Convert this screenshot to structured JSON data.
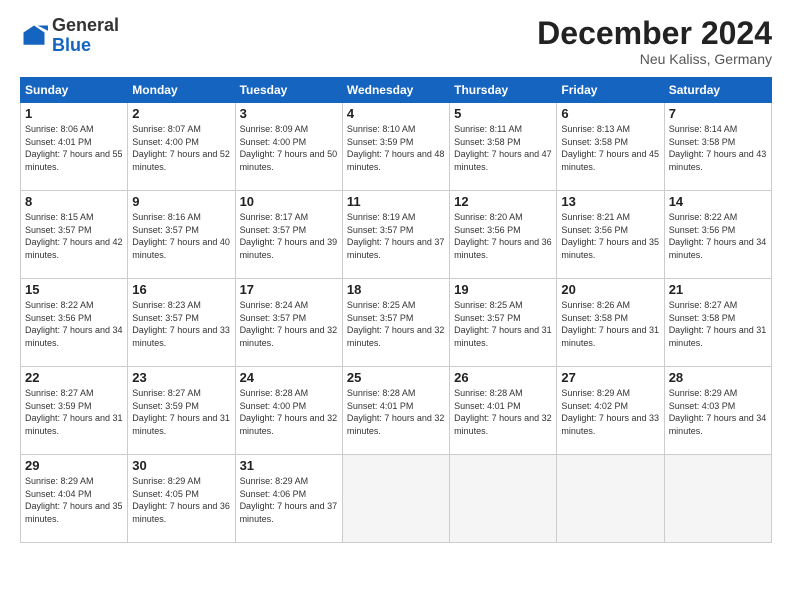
{
  "header": {
    "logo_general": "General",
    "logo_blue": "Blue",
    "month_title": "December 2024",
    "location": "Neu Kaliss, Germany"
  },
  "weekdays": [
    "Sunday",
    "Monday",
    "Tuesday",
    "Wednesday",
    "Thursday",
    "Friday",
    "Saturday"
  ],
  "weeks": [
    [
      {
        "day": "1",
        "sunrise": "Sunrise: 8:06 AM",
        "sunset": "Sunset: 4:01 PM",
        "daylight": "Daylight: 7 hours and 55 minutes."
      },
      {
        "day": "2",
        "sunrise": "Sunrise: 8:07 AM",
        "sunset": "Sunset: 4:00 PM",
        "daylight": "Daylight: 7 hours and 52 minutes."
      },
      {
        "day": "3",
        "sunrise": "Sunrise: 8:09 AM",
        "sunset": "Sunset: 4:00 PM",
        "daylight": "Daylight: 7 hours and 50 minutes."
      },
      {
        "day": "4",
        "sunrise": "Sunrise: 8:10 AM",
        "sunset": "Sunset: 3:59 PM",
        "daylight": "Daylight: 7 hours and 48 minutes."
      },
      {
        "day": "5",
        "sunrise": "Sunrise: 8:11 AM",
        "sunset": "Sunset: 3:58 PM",
        "daylight": "Daylight: 7 hours and 47 minutes."
      },
      {
        "day": "6",
        "sunrise": "Sunrise: 8:13 AM",
        "sunset": "Sunset: 3:58 PM",
        "daylight": "Daylight: 7 hours and 45 minutes."
      },
      {
        "day": "7",
        "sunrise": "Sunrise: 8:14 AM",
        "sunset": "Sunset: 3:58 PM",
        "daylight": "Daylight: 7 hours and 43 minutes."
      }
    ],
    [
      {
        "day": "8",
        "sunrise": "Sunrise: 8:15 AM",
        "sunset": "Sunset: 3:57 PM",
        "daylight": "Daylight: 7 hours and 42 minutes."
      },
      {
        "day": "9",
        "sunrise": "Sunrise: 8:16 AM",
        "sunset": "Sunset: 3:57 PM",
        "daylight": "Daylight: 7 hours and 40 minutes."
      },
      {
        "day": "10",
        "sunrise": "Sunrise: 8:17 AM",
        "sunset": "Sunset: 3:57 PM",
        "daylight": "Daylight: 7 hours and 39 minutes."
      },
      {
        "day": "11",
        "sunrise": "Sunrise: 8:19 AM",
        "sunset": "Sunset: 3:57 PM",
        "daylight": "Daylight: 7 hours and 37 minutes."
      },
      {
        "day": "12",
        "sunrise": "Sunrise: 8:20 AM",
        "sunset": "Sunset: 3:56 PM",
        "daylight": "Daylight: 7 hours and 36 minutes."
      },
      {
        "day": "13",
        "sunrise": "Sunrise: 8:21 AM",
        "sunset": "Sunset: 3:56 PM",
        "daylight": "Daylight: 7 hours and 35 minutes."
      },
      {
        "day": "14",
        "sunrise": "Sunrise: 8:22 AM",
        "sunset": "Sunset: 3:56 PM",
        "daylight": "Daylight: 7 hours and 34 minutes."
      }
    ],
    [
      {
        "day": "15",
        "sunrise": "Sunrise: 8:22 AM",
        "sunset": "Sunset: 3:56 PM",
        "daylight": "Daylight: 7 hours and 34 minutes."
      },
      {
        "day": "16",
        "sunrise": "Sunrise: 8:23 AM",
        "sunset": "Sunset: 3:57 PM",
        "daylight": "Daylight: 7 hours and 33 minutes."
      },
      {
        "day": "17",
        "sunrise": "Sunrise: 8:24 AM",
        "sunset": "Sunset: 3:57 PM",
        "daylight": "Daylight: 7 hours and 32 minutes."
      },
      {
        "day": "18",
        "sunrise": "Sunrise: 8:25 AM",
        "sunset": "Sunset: 3:57 PM",
        "daylight": "Daylight: 7 hours and 32 minutes."
      },
      {
        "day": "19",
        "sunrise": "Sunrise: 8:25 AM",
        "sunset": "Sunset: 3:57 PM",
        "daylight": "Daylight: 7 hours and 31 minutes."
      },
      {
        "day": "20",
        "sunrise": "Sunrise: 8:26 AM",
        "sunset": "Sunset: 3:58 PM",
        "daylight": "Daylight: 7 hours and 31 minutes."
      },
      {
        "day": "21",
        "sunrise": "Sunrise: 8:27 AM",
        "sunset": "Sunset: 3:58 PM",
        "daylight": "Daylight: 7 hours and 31 minutes."
      }
    ],
    [
      {
        "day": "22",
        "sunrise": "Sunrise: 8:27 AM",
        "sunset": "Sunset: 3:59 PM",
        "daylight": "Daylight: 7 hours and 31 minutes."
      },
      {
        "day": "23",
        "sunrise": "Sunrise: 8:27 AM",
        "sunset": "Sunset: 3:59 PM",
        "daylight": "Daylight: 7 hours and 31 minutes."
      },
      {
        "day": "24",
        "sunrise": "Sunrise: 8:28 AM",
        "sunset": "Sunset: 4:00 PM",
        "daylight": "Daylight: 7 hours and 32 minutes."
      },
      {
        "day": "25",
        "sunrise": "Sunrise: 8:28 AM",
        "sunset": "Sunset: 4:01 PM",
        "daylight": "Daylight: 7 hours and 32 minutes."
      },
      {
        "day": "26",
        "sunrise": "Sunrise: 8:28 AM",
        "sunset": "Sunset: 4:01 PM",
        "daylight": "Daylight: 7 hours and 32 minutes."
      },
      {
        "day": "27",
        "sunrise": "Sunrise: 8:29 AM",
        "sunset": "Sunset: 4:02 PM",
        "daylight": "Daylight: 7 hours and 33 minutes."
      },
      {
        "day": "28",
        "sunrise": "Sunrise: 8:29 AM",
        "sunset": "Sunset: 4:03 PM",
        "daylight": "Daylight: 7 hours and 34 minutes."
      }
    ],
    [
      {
        "day": "29",
        "sunrise": "Sunrise: 8:29 AM",
        "sunset": "Sunset: 4:04 PM",
        "daylight": "Daylight: 7 hours and 35 minutes."
      },
      {
        "day": "30",
        "sunrise": "Sunrise: 8:29 AM",
        "sunset": "Sunset: 4:05 PM",
        "daylight": "Daylight: 7 hours and 36 minutes."
      },
      {
        "day": "31",
        "sunrise": "Sunrise: 8:29 AM",
        "sunset": "Sunset: 4:06 PM",
        "daylight": "Daylight: 7 hours and 37 minutes."
      },
      null,
      null,
      null,
      null
    ]
  ]
}
